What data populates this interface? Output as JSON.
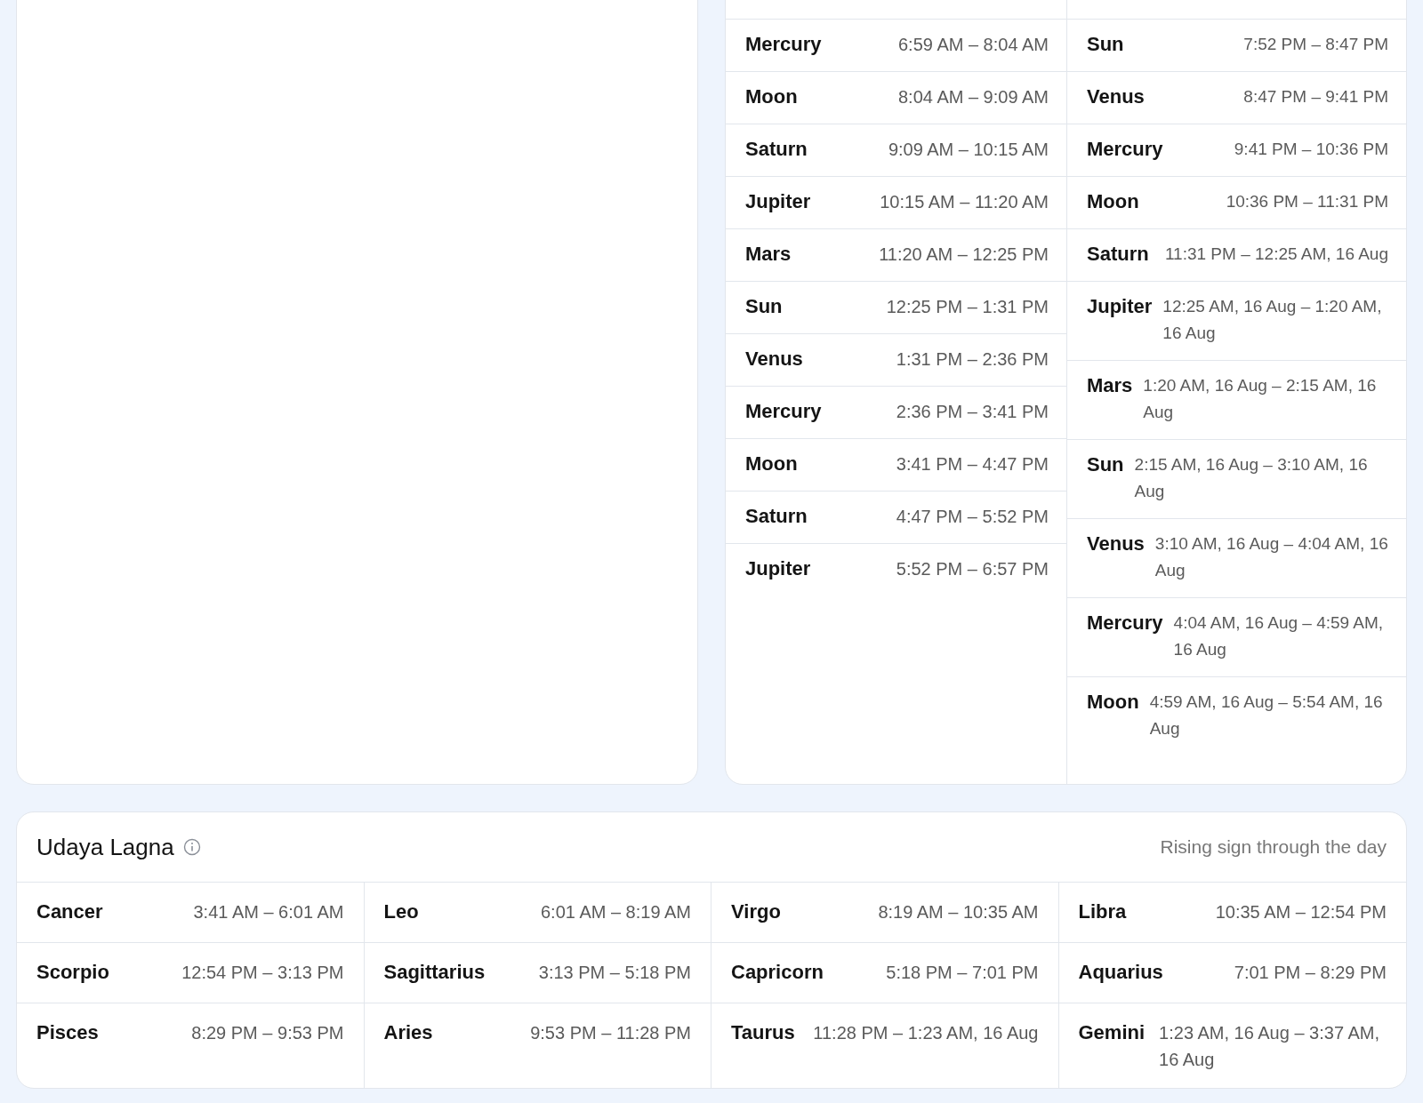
{
  "hora": {
    "day": [
      {
        "planet": "Mercury",
        "time": "6:59 AM – 8:04 AM"
      },
      {
        "planet": "Moon",
        "time": "8:04 AM – 9:09 AM"
      },
      {
        "planet": "Saturn",
        "time": "9:09 AM – 10:15 AM"
      },
      {
        "planet": "Jupiter",
        "time": "10:15 AM – 11:20 AM"
      },
      {
        "planet": "Mars",
        "time": "11:20 AM – 12:25 PM"
      },
      {
        "planet": "Sun",
        "time": "12:25 PM – 1:31 PM"
      },
      {
        "planet": "Venus",
        "time": "1:31 PM – 2:36 PM"
      },
      {
        "planet": "Mercury",
        "time": "2:36 PM – 3:41 PM"
      },
      {
        "planet": "Moon",
        "time": "3:41 PM – 4:47 PM"
      },
      {
        "planet": "Saturn",
        "time": "4:47 PM – 5:52 PM"
      },
      {
        "planet": "Jupiter",
        "time": "5:52 PM – 6:57 PM"
      }
    ],
    "night": [
      {
        "planet": "Sun",
        "time": "7:52 PM – 8:47 PM"
      },
      {
        "planet": "Venus",
        "time": "8:47 PM – 9:41 PM"
      },
      {
        "planet": "Mercury",
        "time": "9:41 PM – 10:36 PM"
      },
      {
        "planet": "Moon",
        "time": "10:36 PM – 11:31 PM"
      },
      {
        "planet": "Saturn",
        "time": "11:31 PM – 12:25 AM, 16 Aug"
      },
      {
        "planet": "Jupiter",
        "time": "12:25 AM, 16 Aug – 1:20 AM, 16 Aug"
      },
      {
        "planet": "Mars",
        "time": "1:20 AM, 16 Aug – 2:15 AM, 16 Aug"
      },
      {
        "planet": "Sun",
        "time": "2:15 AM, 16 Aug – 3:10 AM, 16 Aug"
      },
      {
        "planet": "Venus",
        "time": "3:10 AM, 16 Aug – 4:04 AM, 16 Aug"
      },
      {
        "planet": "Mercury",
        "time": "4:04 AM, 16 Aug – 4:59 AM, 16 Aug"
      },
      {
        "planet": "Moon",
        "time": "4:59 AM, 16 Aug – 5:54 AM, 16 Aug"
      }
    ]
  },
  "udaya_lagna": {
    "title": "Udaya Lagna",
    "subtitle": "Rising sign through the day",
    "signs": [
      {
        "sign": "Cancer",
        "time": "3:41 AM – 6:01 AM"
      },
      {
        "sign": "Leo",
        "time": "6:01 AM – 8:19 AM"
      },
      {
        "sign": "Virgo",
        "time": "8:19 AM – 10:35 AM"
      },
      {
        "sign": "Libra",
        "time": "10:35 AM – 12:54 PM"
      },
      {
        "sign": "Scorpio",
        "time": "12:54 PM – 3:13 PM"
      },
      {
        "sign": "Sagittarius",
        "time": "3:13 PM – 5:18 PM"
      },
      {
        "sign": "Capricorn",
        "time": "5:18 PM – 7:01 PM"
      },
      {
        "sign": "Aquarius",
        "time": "7:01 PM – 8:29 PM"
      },
      {
        "sign": "Pisces",
        "time": "8:29 PM – 9:53 PM"
      },
      {
        "sign": "Aries",
        "time": "9:53 PM – 11:28 PM"
      },
      {
        "sign": "Taurus",
        "time": "11:28 PM – 1:23 AM, 16 Aug"
      },
      {
        "sign": "Gemini",
        "time": "1:23 AM, 16 Aug – 3:37 AM, 16 Aug"
      }
    ]
  }
}
